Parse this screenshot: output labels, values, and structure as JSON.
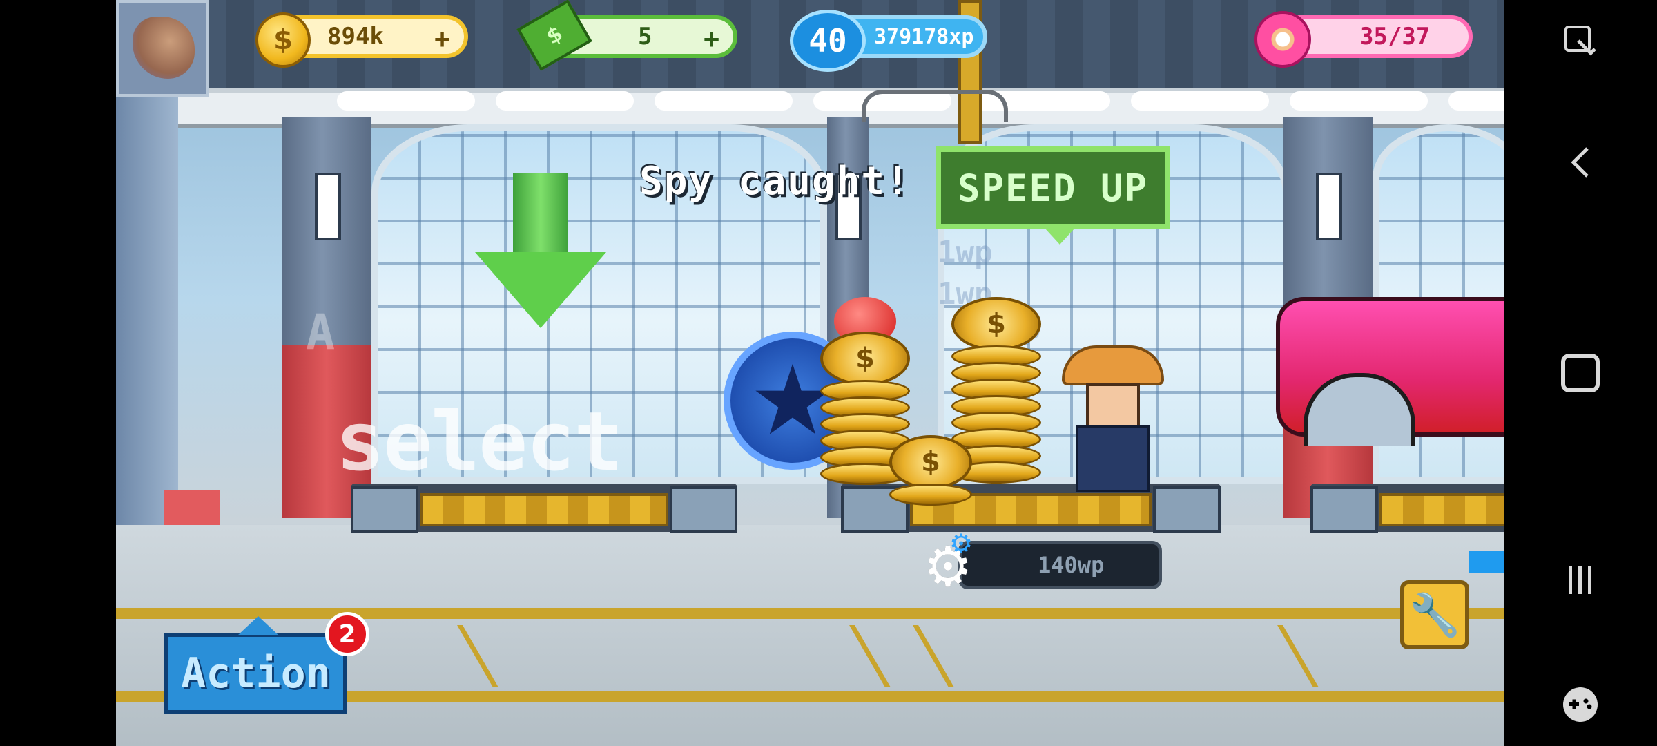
{
  "hud": {
    "coins": "894k",
    "cash": "5",
    "level": "40",
    "xp": "379178xp",
    "donuts": "35/37",
    "plus": "+"
  },
  "scene": {
    "spy_message": "Spy caught!",
    "speed_up_label": "SPEED UP",
    "select_label": "select",
    "workpoints": "140wp",
    "floating_wp": [
      "1wp",
      "1wp",
      "1wp"
    ],
    "pillar_letter": "A"
  },
  "controls": {
    "action_label": "Action",
    "action_badge_count": "2"
  },
  "colors": {
    "coin": "#f3c32c",
    "cash": "#5bbd3b",
    "xp": "#3fb4f1",
    "donut": "#ff69b3",
    "speed_up": "#3e7d2e",
    "action": "#2a8fd8"
  },
  "icons": {
    "coin": "dollar-coin-icon",
    "cash": "cash-bill-icon",
    "level": "level-badge-icon",
    "donut": "donut-icon",
    "gear": "gear-icon",
    "wrench": "wrench-icon",
    "nav_screenshot": "screenshot-edit-icon",
    "nav_back": "back-icon",
    "nav_home": "home-icon",
    "nav_recents": "recents-icon",
    "nav_game": "game-controller-icon"
  }
}
